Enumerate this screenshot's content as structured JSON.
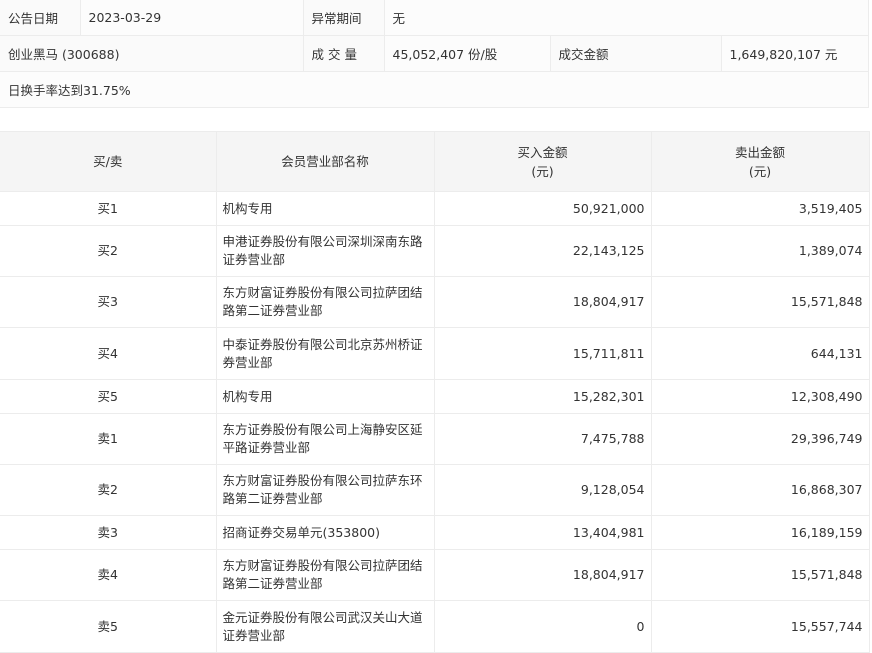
{
  "info": {
    "announce_label": "公告日期",
    "announce_date": "2023-03-29",
    "period_label": "异常期间",
    "period_value": "无",
    "stock": "创业黑马 (300688)",
    "volume_label": "成 交 量",
    "volume_value": "45,052,407 份/股",
    "amount_label": "成交金额",
    "amount_value": "1,649,820,107 元",
    "reason": "日换手率达到31.75%"
  },
  "table": {
    "headers": {
      "side": "买/卖",
      "name": "会员营业部名称",
      "buy_line1": "买入金额",
      "buy_line2": "(元)",
      "sell_line1": "卖出金额",
      "sell_line2": "(元)"
    },
    "rows": [
      {
        "side": "买1",
        "name": "机构专用",
        "buy": "50,921,000",
        "sell": "3,519,405"
      },
      {
        "side": "买2",
        "name": "申港证券股份有限公司深圳深南东路证券营业部",
        "buy": "22,143,125",
        "sell": "1,389,074"
      },
      {
        "side": "买3",
        "name": "东方财富证券股份有限公司拉萨团结路第二证券营业部",
        "buy": "18,804,917",
        "sell": "15,571,848"
      },
      {
        "side": "买4",
        "name": "中泰证券股份有限公司北京苏州桥证券营业部",
        "buy": "15,711,811",
        "sell": "644,131"
      },
      {
        "side": "买5",
        "name": "机构专用",
        "buy": "15,282,301",
        "sell": "12,308,490"
      },
      {
        "side": "卖1",
        "name": "东方证券股份有限公司上海静安区延平路证券营业部",
        "buy": "7,475,788",
        "sell": "29,396,749"
      },
      {
        "side": "卖2",
        "name": "东方财富证券股份有限公司拉萨东环路第二证券营业部",
        "buy": "9,128,054",
        "sell": "16,868,307"
      },
      {
        "side": "卖3",
        "name": "招商证券交易单元(353800)",
        "buy": "13,404,981",
        "sell": "16,189,159"
      },
      {
        "side": "卖4",
        "name": "东方财富证券股份有限公司拉萨团结路第二证券营业部",
        "buy": "18,804,917",
        "sell": "15,571,848"
      },
      {
        "side": "卖5",
        "name": "金元证券股份有限公司武汉关山大道证券营业部",
        "buy": "0",
        "sell": "15,557,744"
      }
    ]
  }
}
